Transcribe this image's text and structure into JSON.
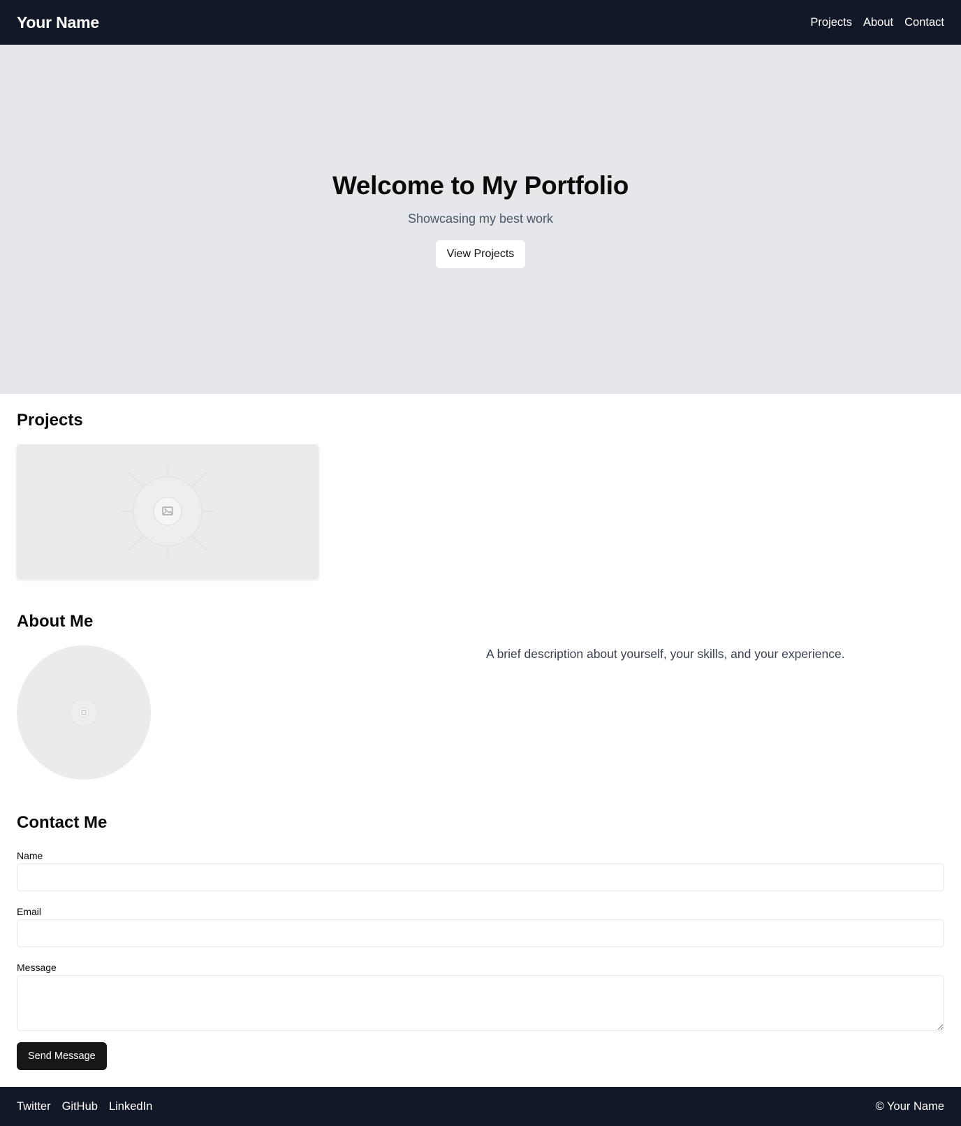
{
  "header": {
    "brand": "Your Name",
    "nav": [
      "Projects",
      "About",
      "Contact"
    ]
  },
  "hero": {
    "title": "Welcome to My Portfolio",
    "subtitle": "Showcasing my best work",
    "cta_label": "View Projects"
  },
  "projects": {
    "title": "Projects",
    "card_image_icon": "image-placeholder-icon"
  },
  "about": {
    "title": "About Me",
    "avatar_icon": "image-placeholder-icon",
    "description": "A brief description about yourself, your skills, and your experience."
  },
  "contact": {
    "title": "Contact Me",
    "fields": {
      "name_label": "Name",
      "name_value": "",
      "email_label": "Email",
      "email_value": "",
      "message_label": "Message",
      "message_value": ""
    },
    "submit_label": "Send Message"
  },
  "footer": {
    "social": [
      "Twitter",
      "GitHub",
      "LinkedIn"
    ],
    "copyright": "© Your Name"
  },
  "colors": {
    "header_bg": "#111827",
    "hero_bg": "#e5e7eb",
    "button_dark": "#171717",
    "text_muted": "#4b5563"
  }
}
